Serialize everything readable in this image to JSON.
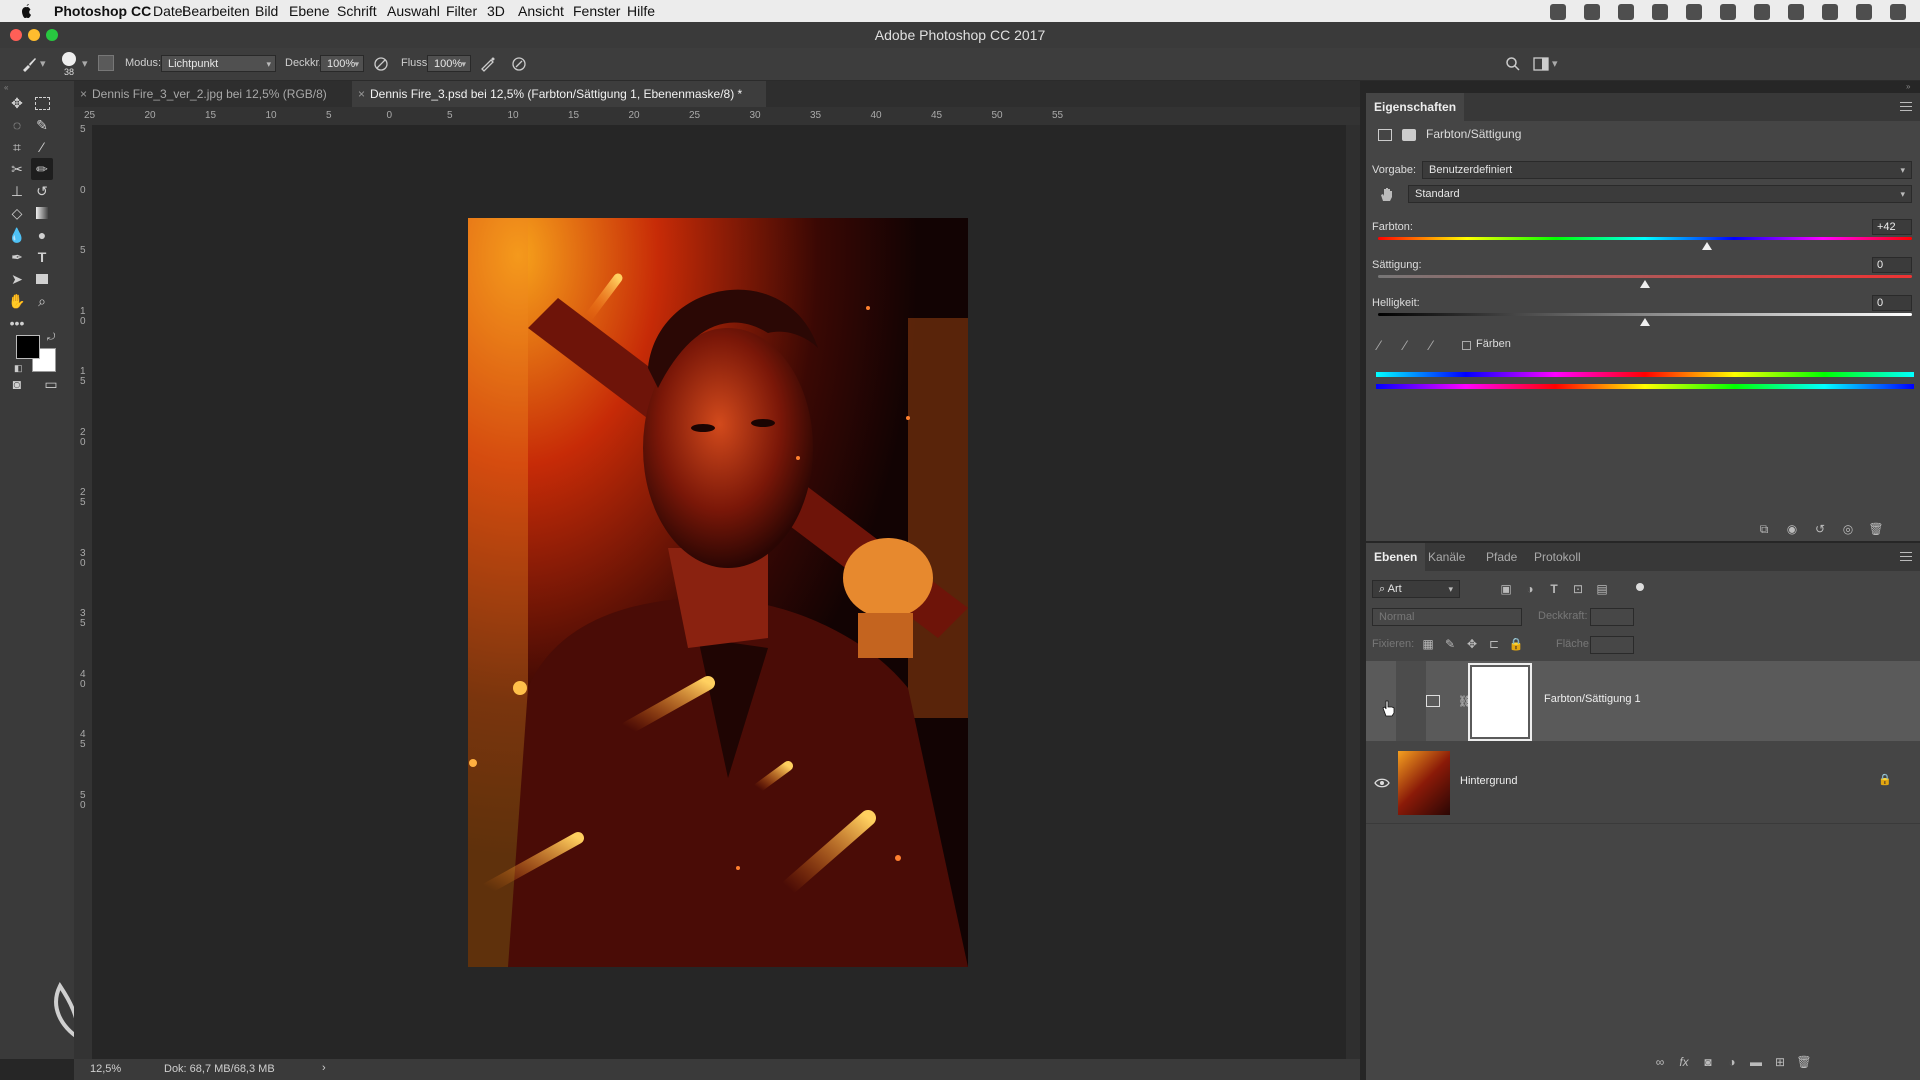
{
  "menubar": {
    "app_name": "Photoshop CC",
    "items": [
      "Datei",
      "Bearbeiten",
      "Bild",
      "Ebene",
      "Schrift",
      "Auswahl",
      "Filter",
      "3D",
      "Ansicht",
      "Fenster",
      "Hilfe"
    ]
  },
  "window": {
    "title": "Adobe Photoshop CC 2017"
  },
  "options_bar": {
    "brush_size": "38",
    "mode_label": "Modus:",
    "mode_value": "Lichtpunkt",
    "opacity_label": "Deckkr.:",
    "opacity_value": "100%",
    "flow_label": "Fluss:",
    "flow_value": "100%"
  },
  "tabs": [
    {
      "label": "Dennis Fire_3_ver_2.jpg bei 12,5% (RGB/8)",
      "active": false
    },
    {
      "label": "Dennis Fire_3.psd bei 12,5% (Farbton/Sättigung 1, Ebenenmaske/8) *",
      "active": true
    }
  ],
  "ruler": {
    "top_labels": [
      "25",
      "20",
      "15",
      "10",
      "5",
      "0",
      "5",
      "10",
      "15",
      "20",
      "25",
      "30",
      "35",
      "40",
      "45",
      "50",
      "55"
    ],
    "left_labels": [
      "5",
      "0",
      "5",
      "1\n0",
      "1\n5",
      "2\n0",
      "2\n5",
      "3\n0",
      "3\n5",
      "4\n0",
      "4\n5",
      "5\n0"
    ]
  },
  "status_bar": {
    "zoom": "12,5%",
    "doc_info": "Dok: 68,7 MB/68,3 MB",
    "arrow": "›"
  },
  "properties_panel": {
    "tab_label": "Eigenschaften",
    "adjustment_title": "Farbton/Sättigung",
    "preset_label": "Vorgabe:",
    "preset_value": "Benutzerdefiniert",
    "channel_value": "Standard",
    "hue_label": "Farbton:",
    "hue_value": "+42",
    "hue_level": 0.617,
    "saturation_label": "Sättigung:",
    "saturation_value": "0",
    "saturation_level": 0.5,
    "lightness_label": "Helligkeit:",
    "lightness_value": "0",
    "lightness_level": 0.5,
    "colorize_label": "Färben"
  },
  "layers_panel": {
    "tabs": [
      "Ebenen",
      "Kanäle",
      "Pfade",
      "Protokoll"
    ],
    "filter_kind": "Art",
    "blend_mode": "Normal",
    "opacity_label": "Deckkraft:",
    "lock_label": "Fixieren:",
    "fill_label": "Fläche:",
    "layers": [
      {
        "name": "Farbton/Sättigung 1",
        "selected": true
      },
      {
        "name": "Hintergrund",
        "selected": false
      }
    ]
  },
  "colors": {
    "accent": "#3d3d3d",
    "panel": "#454545",
    "selected_layer": "#5a5a5a"
  }
}
